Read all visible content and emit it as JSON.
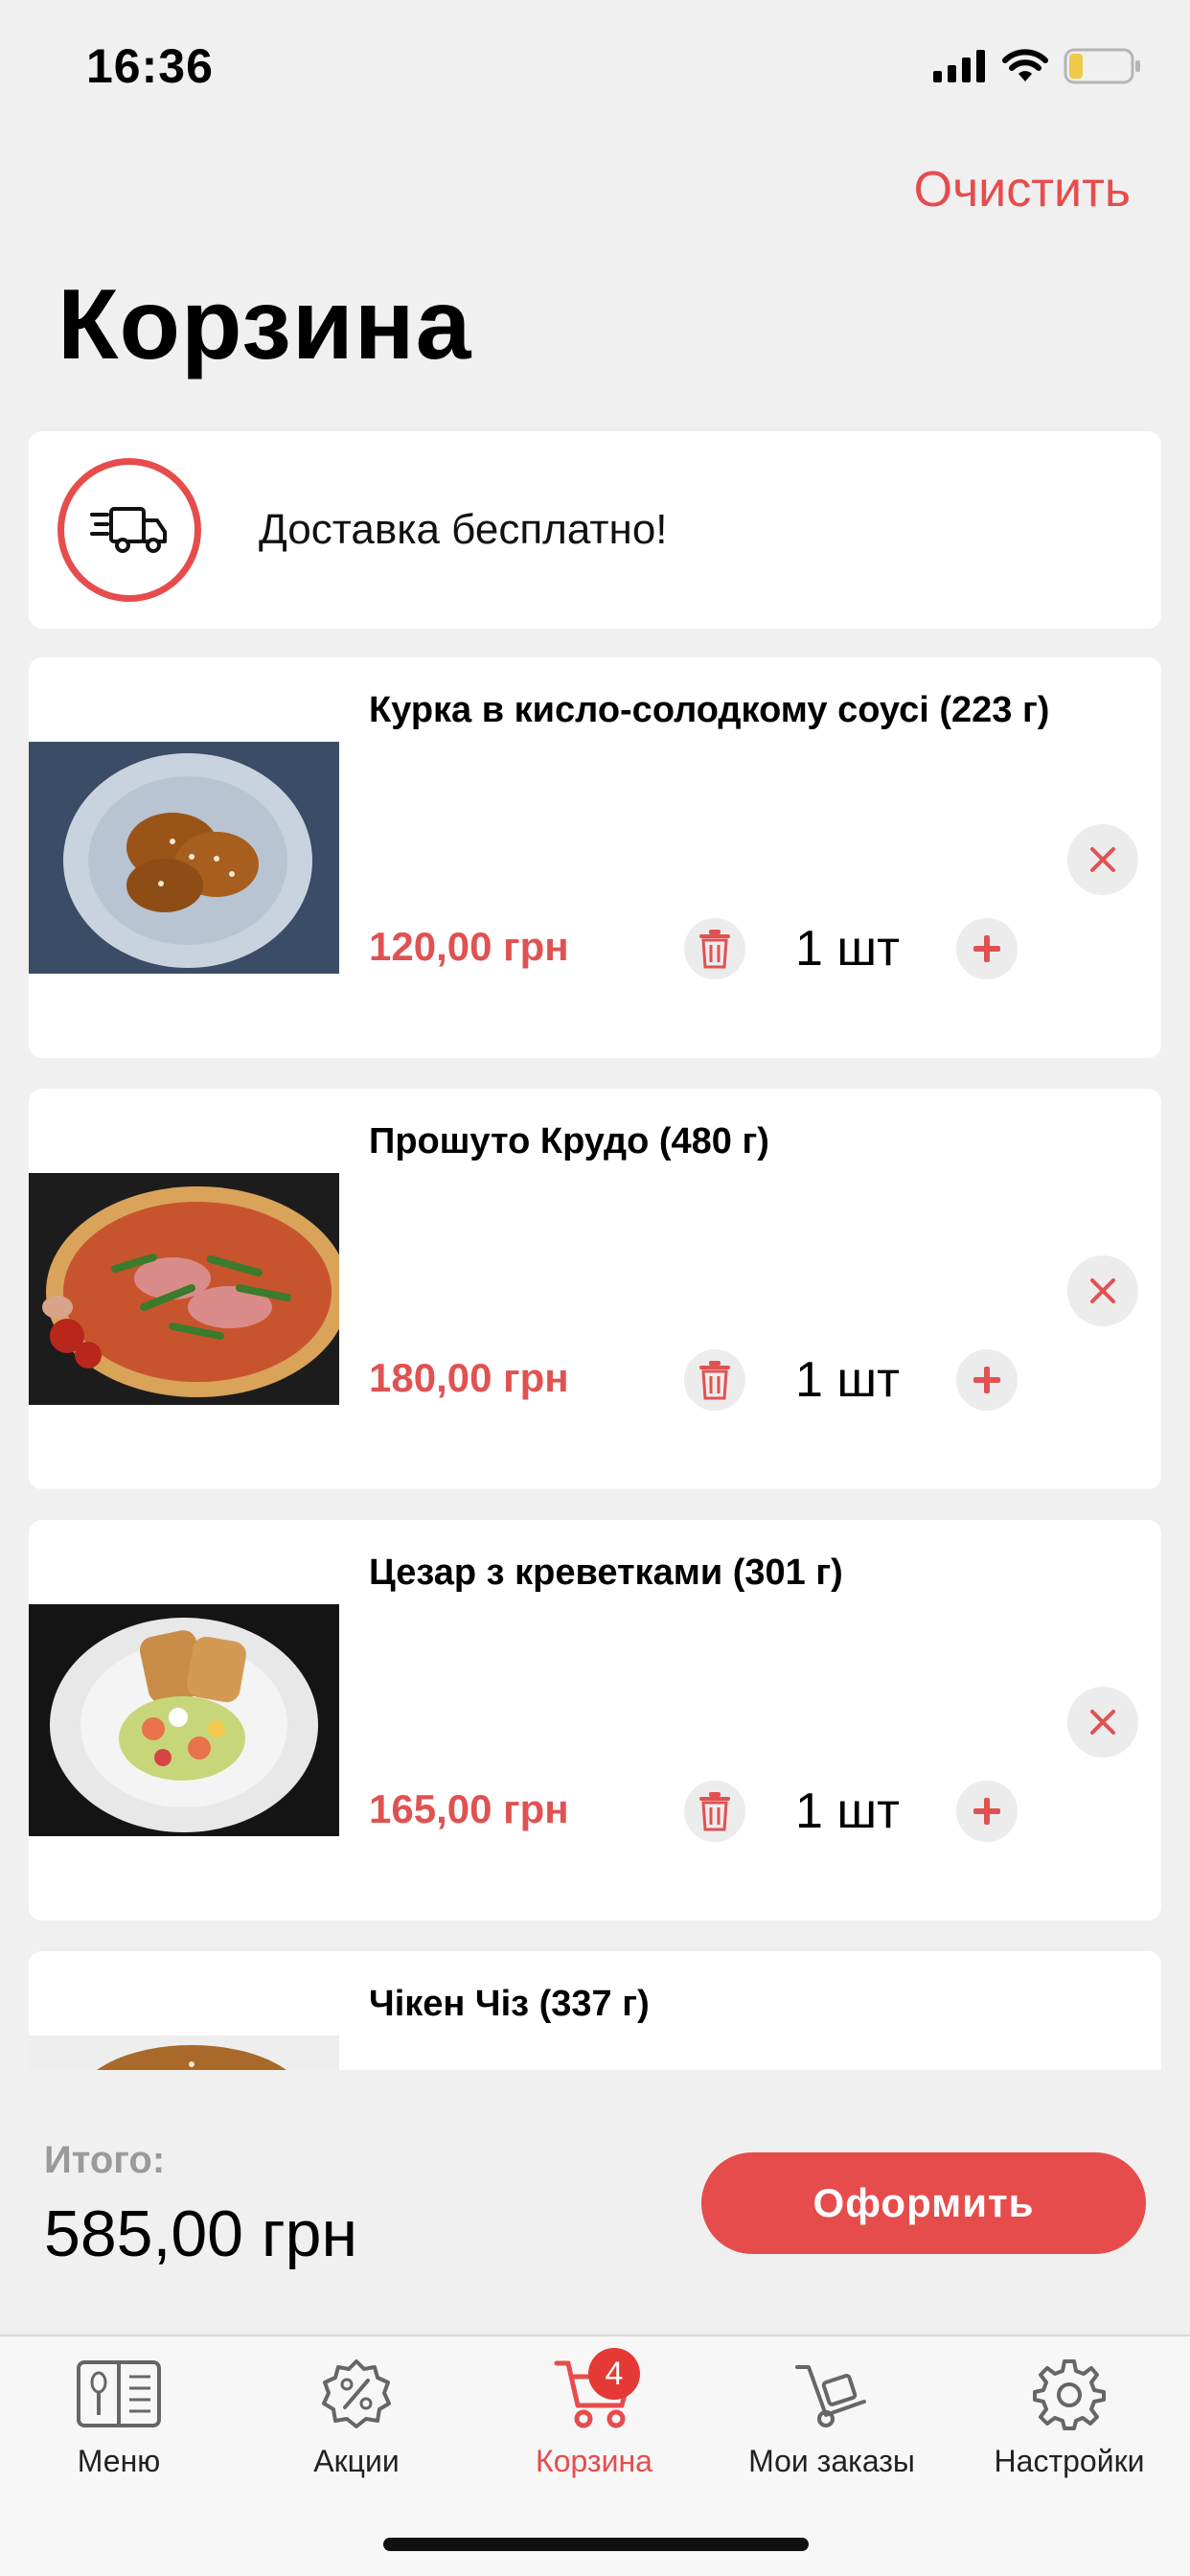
{
  "status": {
    "time": "16:36"
  },
  "header": {
    "clear_label": "Очистить",
    "title": "Корзина"
  },
  "delivery": {
    "text": "Доставка бесплатно!",
    "icon": "truck-icon"
  },
  "items": [
    {
      "name": "Курка в кисло-солодкому соусі (223 г)",
      "price": "120,00 грн",
      "qty": "1 шт"
    },
    {
      "name": "Прошуто Крудо (480 г)",
      "price": "180,00 грн",
      "qty": "1 шт"
    },
    {
      "name": "Цезар з креветками (301 г)",
      "price": "165,00 грн",
      "qty": "1 шт"
    },
    {
      "name": "Чікен Чіз (337 г)",
      "price": "",
      "qty": ""
    }
  ],
  "summary": {
    "total_label": "Итого:",
    "total_value": "585,00 грн",
    "checkout_label": "Оформить"
  },
  "tabs": [
    {
      "label": "Меню",
      "icon": "menu-book-icon"
    },
    {
      "label": "Акции",
      "icon": "discount-icon"
    },
    {
      "label": "Корзина",
      "icon": "cart-icon",
      "badge": "4",
      "active": true
    },
    {
      "label": "Мои заказы",
      "icon": "hand-truck-icon"
    },
    {
      "label": "Настройки",
      "icon": "gear-icon"
    }
  ],
  "colors": {
    "accent": "#e74c4c",
    "background": "#f0f0f0"
  }
}
